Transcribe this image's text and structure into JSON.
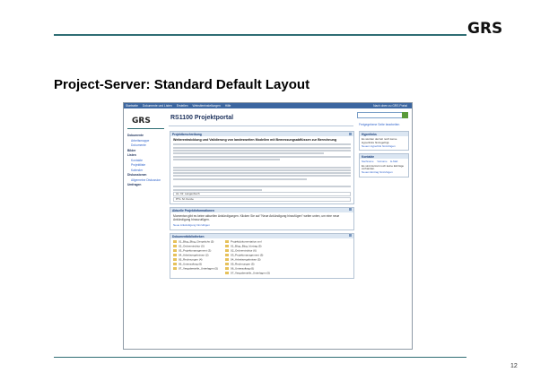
{
  "slide": {
    "brand": "GRS",
    "title": "Project-Server: Standard Default Layout",
    "page_number": "12"
  },
  "portal": {
    "nav_items": [
      "Startseite",
      "Dokumente und Listen",
      "Erstellen",
      "Websiteeinstellungen",
      "Hilfe"
    ],
    "nav_right": "Nach oben zu GRS Portal",
    "logo": "GRS",
    "site_title": "RS1100 Projektportal",
    "action_link": "Freigegebene Seite bearbeiten",
    "sidebar": [
      {
        "label": "Dokumente",
        "level": "head"
      },
      {
        "label": "Arbeitsmappe",
        "level": "sub"
      },
      {
        "label": "Dokumente",
        "level": "sub"
      },
      {
        "label": "Bilder",
        "level": "head"
      },
      {
        "label": "Listen",
        "level": "head"
      },
      {
        "label": "Kontakte",
        "level": "sub"
      },
      {
        "label": "Projektliste",
        "level": "sub"
      },
      {
        "label": "Kalender",
        "level": "sub"
      },
      {
        "label": "Diskussionen",
        "level": "head"
      },
      {
        "label": "Allgemeine Diskussion",
        "level": "sub"
      },
      {
        "label": "Umfragen",
        "level": "head"
      }
    ],
    "project_desc": {
      "header": "Projektbeschreibung",
      "heading": "Weiterentwicklung und Validierung von landesweiten Modellen mit Bemessungsabflüssen zur Berechnung",
      "info_rows": [
        "AL: Dr. Langenbuch",
        "PTL: M. Kunze"
      ]
    },
    "announcements": {
      "header": "Aktuelle Projektinformationen",
      "text": "Momentan gibt es keine aktuellen Ankündigungen. Klicken Sie auf \"Neue Ankündigung hinzufügen\" weiter unten, um eine neue Ankündigung hinzuzufügen.",
      "link": "Neue Ankündigung hinzufügen"
    },
    "docs": {
      "header": "Dokumentbibliotheken",
      "left": [
        "01_Blog_Blog_Gesprächs (5)",
        "02_Ordnerstruktur (5)",
        "03_Projektmanagement (3)",
        "04_Arbeitsergebnisse (2)",
        "05_Rechnungen (4)",
        "06_Unterauftrag (6)",
        "07_Vergabestelle_Unterlagen (5)"
      ],
      "right": [
        "Projektdokumentation.xml",
        "01_Blog_Blog_Vortrag (5)",
        "02_Ordnerstruktur (6)",
        "03_Projektmanagement (5)",
        "04_Arbeitsergebnisse (5)",
        "05_Rechnungen (5)",
        "06_Unterauftrag (6)",
        "07_Vergabestelle_Unterlagen (5)"
      ]
    },
    "right_col": {
      "box1": {
        "header": "Hyperlinks",
        "text": "Es wurden derzeit noch keine Hyperlinks hinzugefügt.",
        "link": "Neuen Hyperlink hinzufügen"
      },
      "box2": {
        "header": "Kontakte",
        "tabs": [
          "Nachname",
          "Vorname",
          "E-Mail"
        ],
        "text": "Es sind derzeit noch keine Einträge vorhanden.",
        "link": "Neuen Eintrag hinzufügen"
      }
    }
  }
}
